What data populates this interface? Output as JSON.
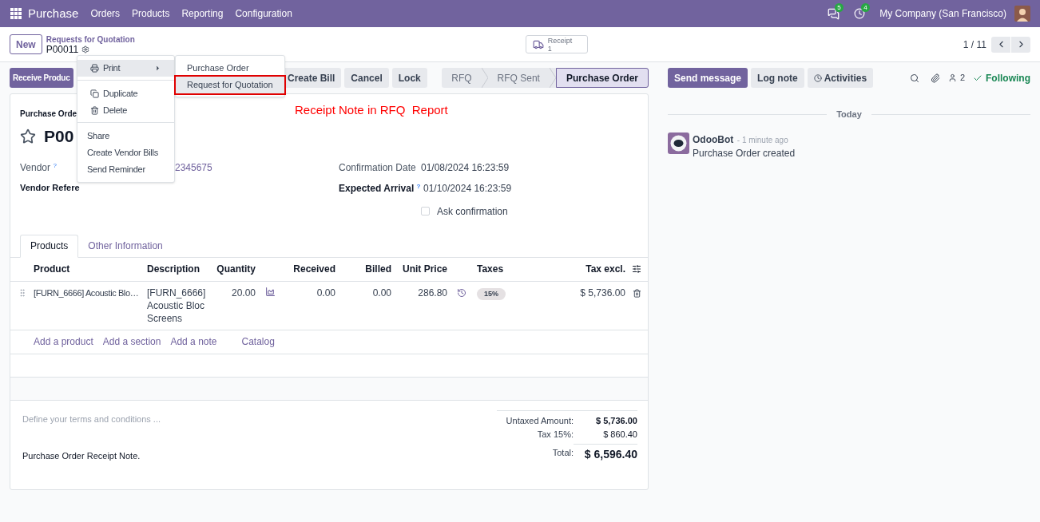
{
  "navbar": {
    "app": "Purchase",
    "menus": [
      "Orders",
      "Products",
      "Reporting",
      "Configuration"
    ],
    "messages_badge": "5",
    "activities_badge": "4",
    "company": "My Company (San Francisco)"
  },
  "control_panel": {
    "new_button": "New",
    "breadcrumb": "Requests for Quotation",
    "record": "P00011",
    "smart_button": {
      "label": "Receipt",
      "count": "1"
    },
    "pager": "1 / 11"
  },
  "actions": [
    {
      "label": "Receive Produc",
      "kind": "primary"
    },
    {
      "label": "Create Bill",
      "kind": "secondary"
    },
    {
      "label": "Cancel",
      "kind": "secondary"
    },
    {
      "label": "Lock",
      "kind": "secondary"
    }
  ],
  "statusbar": [
    {
      "label": "RFQ",
      "selected": false
    },
    {
      "label": "RFQ Sent",
      "selected": false
    },
    {
      "label": "Purchase Order",
      "selected": true
    }
  ],
  "gear_menu": {
    "groups": [
      [
        {
          "label": "Print",
          "kind": "submenu",
          "selected": true
        }
      ],
      [
        {
          "label": "Duplicate",
          "kind": "item",
          "selected": false
        },
        {
          "label": "Delete",
          "kind": "item",
          "selected": false
        }
      ],
      [
        {
          "label": "Share",
          "kind": "item",
          "selected": false
        },
        {
          "label": "Create Vendor Bills",
          "kind": "item",
          "selected": false
        },
        {
          "label": "Send Reminder",
          "kind": "item",
          "selected": false
        }
      ]
    ]
  },
  "print_menu": [
    {
      "label": "Purchase Order",
      "selected": false
    },
    {
      "label": "Request for Quotation",
      "selected": true
    }
  ],
  "annotation": "Receipt Note in RFQ  Report",
  "form": {
    "title_label": "Purchase Orde",
    "name": "P00",
    "starred": false,
    "vendor": {
      "label": "Vendor",
      "help": "?",
      "value": "2345675"
    },
    "vendor_reference": {
      "label": "Vendor Refere"
    },
    "confirmation_date": {
      "label": "Confirmation Date",
      "value": "01/08/2024 16:23:59"
    },
    "expected_arrival": {
      "label": "Expected Arrival",
      "help": "?",
      "value": "01/10/2024 16:23:59"
    },
    "ask_confirmation": {
      "label": "Ask confirmation",
      "checked": false
    },
    "tabs": [
      {
        "label": "Products",
        "selected": true
      },
      {
        "label": "Other Information",
        "selected": false
      }
    ],
    "table": {
      "columns": [
        "Product",
        "Description",
        "Quantity",
        "Received",
        "Billed",
        "Unit Price",
        "Taxes",
        "Tax excl."
      ],
      "rows": [
        {
          "product": "[FURN_6666] Acoustic Blo…",
          "description": "[FURN_6666] Acoustic Bloc Screens",
          "quantity": "20.00",
          "received": "0.00",
          "billed": "0.00",
          "unit_price": "286.80",
          "taxes": "15%",
          "tax_excl": "$ 5,736.00"
        }
      ],
      "add_links": [
        "Add a product",
        "Add a section",
        "Add a note",
        "Catalog"
      ]
    },
    "terms_placeholder": "Define your terms and conditions ...",
    "note": "Purchase Order Receipt Note.",
    "totals": [
      {
        "label": "Untaxed Amount:",
        "value": "$ 5,736.00",
        "kind": "subtotal"
      },
      {
        "label": "Tax 15%:",
        "value": "$ 860.40",
        "kind": "tax"
      },
      {
        "label": "Total:",
        "value": "$ 6,596.40",
        "kind": "total"
      }
    ]
  },
  "chatter": {
    "buttons": [
      {
        "label": "Send message",
        "kind": "primary"
      },
      {
        "label": "Log note",
        "kind": "secondary"
      },
      {
        "label": "Activities",
        "kind": "secondary"
      }
    ],
    "followers": "2",
    "following": "Following",
    "date_separator": "Today",
    "messages": [
      {
        "author": "OdooBot",
        "time": "- 1 minute ago",
        "body": "Purchase Order created"
      }
    ]
  }
}
